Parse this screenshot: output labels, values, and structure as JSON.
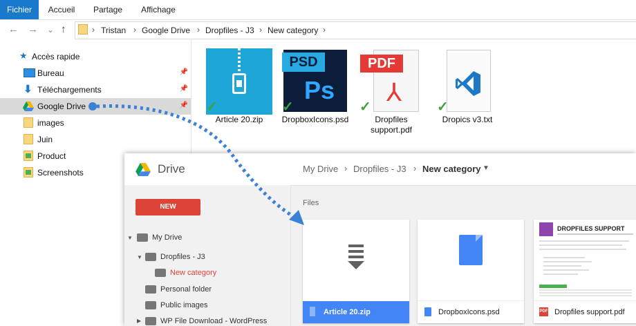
{
  "ribbon": {
    "tabs": [
      "Fichier",
      "Accueil",
      "Partage",
      "Affichage"
    ]
  },
  "nav": {
    "back": "←",
    "forward": "→",
    "dropdown": "⌄",
    "up": "↑"
  },
  "address": {
    "crumbs": [
      "Tristan",
      "Google Drive",
      "Dropfiles - J3",
      "New category"
    ],
    "separator": "›"
  },
  "sidebar": {
    "quick_access": "Accès rapide",
    "items": [
      {
        "label": "Bureau",
        "icon": "desktop-icon"
      },
      {
        "label": "Téléchargements",
        "icon": "download-arrow-icon"
      },
      {
        "label": "Google Drive",
        "icon": "google-drive-icon"
      },
      {
        "label": "images",
        "icon": "folder-icon"
      },
      {
        "label": "Juin",
        "icon": "folder-icon"
      },
      {
        "label": "Product",
        "icon": "image-folder-icon"
      },
      {
        "label": "Screenshots",
        "icon": "image-folder-icon"
      }
    ]
  },
  "files": [
    {
      "label": "Article 20.zip",
      "icon": "zip-icon",
      "accent": "#1ea6d6"
    },
    {
      "label": "DropboxIcons.psd",
      "icon": "photoshop-icon",
      "badge": "PSD",
      "glyph": "Ps",
      "accent": "#0b1d3a"
    },
    {
      "label": "Dropfiles support.pdf",
      "icon": "pdf-icon",
      "badge": "PDF",
      "accent": "#e53935"
    },
    {
      "label": "Dropics v3.txt",
      "icon": "vscode-icon",
      "accent": "#1e78c8"
    }
  ],
  "drive": {
    "brand": "Drive",
    "breadcrumb": [
      "My Drive",
      "Dropfiles - J3",
      "New category"
    ],
    "new_button": "NEW",
    "tree": [
      "My Drive",
      "Dropfiles - J3",
      "New category",
      "Personal folder",
      "Public images",
      "WP File Download - WordPress"
    ],
    "section": "Files",
    "cards": [
      {
        "name": "Article 20.zip",
        "icon": "zip-file-icon",
        "selected": true
      },
      {
        "name": "DropboxIcons.psd",
        "icon": "document-icon",
        "selected": false
      },
      {
        "name": "Dropfiles support.pdf",
        "icon": "pdf-file-icon",
        "selected": false
      }
    ],
    "preview_title": "DROPFILES SUPPORT",
    "colors": {
      "new": "#db4437",
      "selected": "#4285f4",
      "active_tree": "#db4437"
    }
  }
}
